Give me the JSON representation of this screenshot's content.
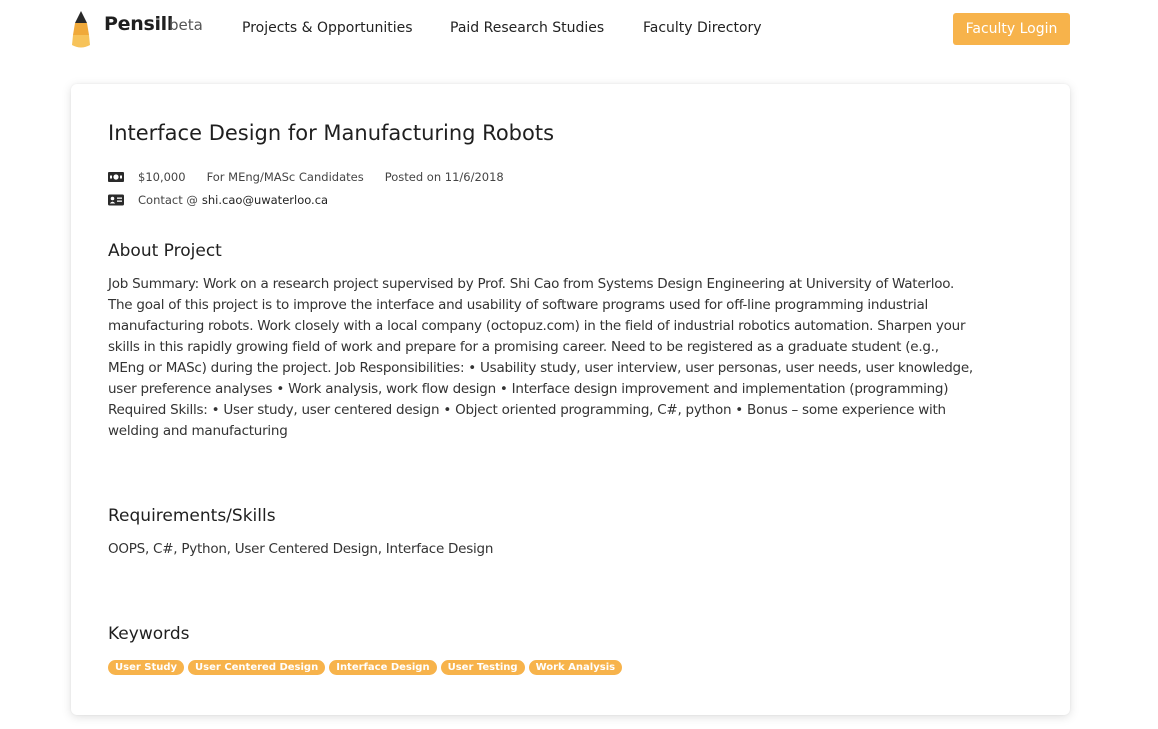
{
  "nav": {
    "brand": "Pensill",
    "beta": "beta",
    "links": [
      "Projects & Opportunities",
      "Paid Research Studies",
      "Faculty Directory"
    ],
    "login": "Faculty Login",
    "accent_color": "#f7b34b"
  },
  "project": {
    "title": "Interface Design for Manufacturing Robots",
    "pay": "$10,000",
    "audience": "For MEng/MASc Candidates",
    "posted": "Posted on 11/6/2018",
    "contact_prefix": "Contact @",
    "contact_email": "shi.cao@uwaterloo.ca",
    "about_heading": "About Project",
    "about_lines": [
      "Job Summary: Work on a research project supervised by Prof. Shi Cao from Systems Design Engineering at University of Waterloo.",
      "The goal of this project is to improve the interface and usability of software programs used for off-line programming industrial",
      "manufacturing robots. Work closely with a local company (octopuz.com) in the field of industrial robotics automation. Sharpen your",
      "skills in this rapidly growing field of work and prepare for a promising career. Need to be registered as a graduate student (e.g.,",
      "MEng or MASc) during the project. Job Responsibilities: • Usability study, user interview, user personas, user needs, user knowledge,",
      "user preference analyses • Work analysis, work flow design • Interface design improvement and implementation (programming)",
      "Required Skills: • User study, user centered design • Object oriented programming, C#, python • Bonus – some experience with",
      "welding and manufacturing"
    ],
    "requirements_heading": "Requirements/Skills",
    "requirements": "OOPS, C#, Python, User Centered Design, Interface Design",
    "keywords_heading": "Keywords",
    "keywords": [
      "User Study",
      "User Centered Design",
      "Interface Design",
      "User Testing",
      "Work Analysis"
    ]
  },
  "icons": {
    "pay": "money-icon",
    "contact": "id-card-icon",
    "logo": "pencil-logo-icon"
  }
}
